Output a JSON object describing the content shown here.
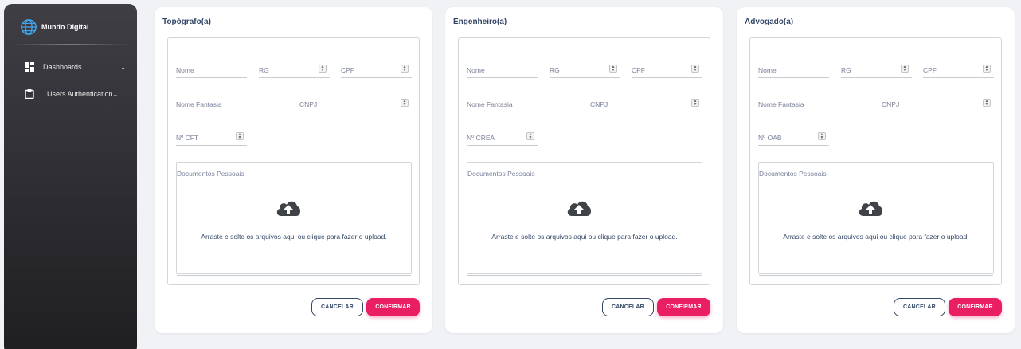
{
  "sidebar": {
    "brand": "Mundo Digital",
    "items": [
      {
        "label": "Dashboards",
        "icon": "dashboard-icon"
      },
      {
        "label": "Users Authentication",
        "icon": "clipboard-icon"
      }
    ]
  },
  "cards": [
    {
      "title": "Topógrafo(a)",
      "fields": {
        "nome": "Nome",
        "rg": "RG",
        "cpf": "CPF",
        "nome_fantasia": "Nome Fantasia",
        "cnpj": "CNPJ",
        "registro": "Nº CFT"
      },
      "dropzone": {
        "label": "Documentos Pessoais",
        "text": "Arraste e solte os arquivos aqui ou clique para fazer o upload."
      },
      "cancel": "CANCELAR",
      "confirm": "CONFIRMAR"
    },
    {
      "title": "Engenheiro(a)",
      "fields": {
        "nome": "Nome",
        "rg": "RG",
        "cpf": "CPF",
        "nome_fantasia": "Nome Fantasia",
        "cnpj": "CNPJ",
        "registro": "Nº CREA"
      },
      "dropzone": {
        "label": "Documentos Pessoais",
        "text": "Arraste e solte os arquivos aqui ou clique para fazer o upload."
      },
      "cancel": "CANCELAR",
      "confirm": "CONFIRMAR"
    },
    {
      "title": "Advogado(a)",
      "fields": {
        "nome": "Nome",
        "rg": "RG",
        "cpf": "CPF",
        "nome_fantasia": "Nome Fantasia",
        "cnpj": "CNPJ",
        "registro": "Nº OAB"
      },
      "dropzone": {
        "label": "Documentos Pessoais",
        "text": "Arraste e solte os arquivos aqui ou clique para fazer o upload."
      },
      "cancel": "CANCELAR",
      "confirm": "CONFIRMAR"
    }
  ],
  "colors": {
    "primary": "#e91e63",
    "text_dark": "#344767",
    "label": "#7b809a",
    "sidebar": "#2a2a2e"
  }
}
